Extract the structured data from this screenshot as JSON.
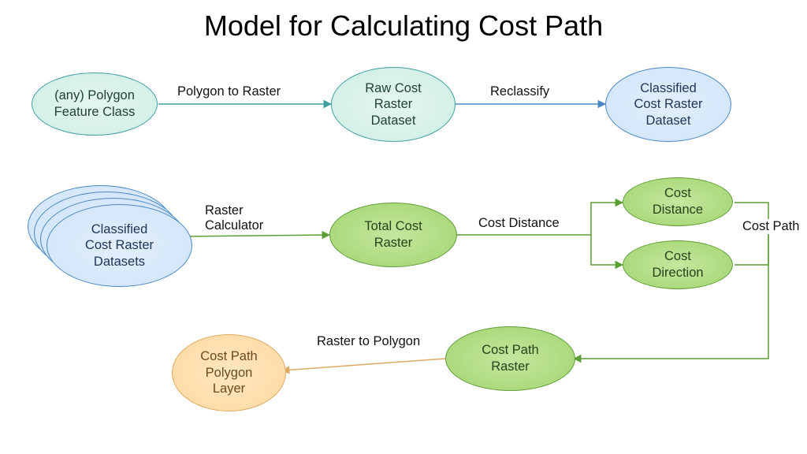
{
  "title": "Model for Calculating Cost Path",
  "nodes": {
    "n1": "(any) Polygon\nFeature Class",
    "n2": "Raw Cost\nRaster\nDataset",
    "n3": "Classified\nCost Raster\nDataset",
    "n4": "Classified\nCost Raster\nDatasets",
    "n5": "Total Cost\nRaster",
    "n6": "Cost\nDistance",
    "n7": "Cost\nDirection",
    "n8": "Cost Path\nRaster",
    "n9": "Cost Path\nPolygon\nLayer"
  },
  "edges": {
    "e1": "Polygon to Raster",
    "e2": "Reclassify",
    "e3": "Raster\nCalculator",
    "e4": "Cost Distance",
    "e5": "Cost Path",
    "e6": "Raster to Polygon"
  },
  "chart_data": {
    "type": "flow",
    "title": "Model for Calculating Cost Path",
    "nodes": [
      {
        "id": "n1",
        "label": "(any) Polygon Feature Class",
        "role": "input"
      },
      {
        "id": "n2",
        "label": "Raw Cost Raster Dataset",
        "role": "intermediate"
      },
      {
        "id": "n3",
        "label": "Classified Cost Raster Dataset",
        "role": "intermediate"
      },
      {
        "id": "n4",
        "label": "Classified Cost Raster Datasets",
        "role": "input",
        "stack": true
      },
      {
        "id": "n5",
        "label": "Total Cost Raster",
        "role": "intermediate"
      },
      {
        "id": "n6",
        "label": "Cost Distance",
        "role": "intermediate"
      },
      {
        "id": "n7",
        "label": "Cost Direction",
        "role": "intermediate"
      },
      {
        "id": "n8",
        "label": "Cost Path Raster",
        "role": "intermediate"
      },
      {
        "id": "n9",
        "label": "Cost Path Polygon Layer",
        "role": "output"
      }
    ],
    "edges": [
      {
        "from": "n1",
        "to": "n2",
        "label": "Polygon to Raster"
      },
      {
        "from": "n2",
        "to": "n3",
        "label": "Reclassify"
      },
      {
        "from": "n4",
        "to": "n5",
        "label": "Raster Calculator"
      },
      {
        "from": "n5",
        "to": "n6",
        "label": "Cost Distance"
      },
      {
        "from": "n5",
        "to": "n7",
        "label": "Cost Distance"
      },
      {
        "from": "n6",
        "to": "n8",
        "label": "Cost Path"
      },
      {
        "from": "n7",
        "to": "n8",
        "label": "Cost Path"
      },
      {
        "from": "n8",
        "to": "n9",
        "label": "Raster to Polygon"
      }
    ]
  }
}
